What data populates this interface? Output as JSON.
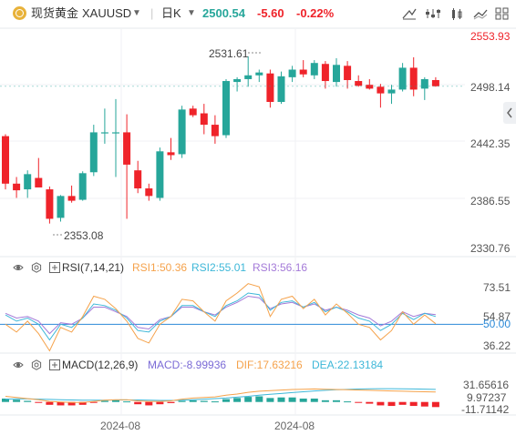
{
  "header": {
    "symbol_name": "现货黄金",
    "symbol_code": "XAUUSD",
    "timeframe": "日K",
    "price": "2500.54",
    "change": "-5.60",
    "change_pct": "-0.22%",
    "tools": [
      "tool-a-icon",
      "tool-b-icon",
      "tool-c-icon",
      "tool-d-icon",
      "grid-icon"
    ]
  },
  "price_axis": [
    "2553.93",
    "2498.14",
    "2442.35",
    "2386.55",
    "2330.76"
  ],
  "price_annotations": {
    "high": "2531.61",
    "low": "2353.08"
  },
  "rsi": {
    "title": "RSI(7,14,21)",
    "rsi1": "RSI1:50.36",
    "rsi2": "RSI2:55.01",
    "rsi3": "RSI3:56.16",
    "axis": [
      "73.51",
      "54.87",
      "50.00",
      "36.22"
    ]
  },
  "macd": {
    "title": "MACD(12,26,9)",
    "macd": "MACD:-8.99936",
    "dif": "DIF:17.63216",
    "dea": "DEA:22.13184",
    "axis": [
      "31.65616",
      "9.97237",
      "-11.71142"
    ]
  },
  "date_labels": [
    "2024-08",
    "2024-08"
  ],
  "colors": {
    "up": "#26a69a",
    "down": "#ef232a",
    "rsi1": "#f5a24b",
    "rsi2": "#3db7d8",
    "rsi3": "#a47ad8",
    "macd": "#7b6bd6",
    "dif": "#f5a24b",
    "dea": "#3db7d8",
    "zero_line": "#2b8ad8"
  },
  "chart_data": {
    "type": "candlestick",
    "candles": [
      {
        "o": 2448,
        "h": 2450,
        "l": 2392,
        "c": 2398
      },
      {
        "o": 2398,
        "h": 2405,
        "l": 2383,
        "c": 2391
      },
      {
        "o": 2392,
        "h": 2412,
        "l": 2383,
        "c": 2408
      },
      {
        "o": 2404,
        "h": 2425,
        "l": 2396,
        "c": 2394
      },
      {
        "o": 2392,
        "h": 2395,
        "l": 2356,
        "c": 2361
      },
      {
        "o": 2362,
        "h": 2386,
        "l": 2358,
        "c": 2385
      },
      {
        "o": 2385,
        "h": 2396,
        "l": 2378,
        "c": 2380
      },
      {
        "o": 2381,
        "h": 2411,
        "l": 2380,
        "c": 2409
      },
      {
        "o": 2410,
        "h": 2460,
        "l": 2406,
        "c": 2452
      },
      {
        "o": 2452,
        "h": 2477,
        "l": 2440,
        "c": 2452
      },
      {
        "o": 2451,
        "h": 2487,
        "l": 2405,
        "c": 2452
      },
      {
        "o": 2452,
        "h": 2471,
        "l": 2361,
        "c": 2418
      },
      {
        "o": 2412,
        "h": 2422,
        "l": 2388,
        "c": 2393
      },
      {
        "o": 2393,
        "h": 2398,
        "l": 2380,
        "c": 2385
      },
      {
        "o": 2383,
        "h": 2436,
        "l": 2380,
        "c": 2432
      },
      {
        "o": 2431,
        "h": 2446,
        "l": 2423,
        "c": 2428
      },
      {
        "o": 2429,
        "h": 2480,
        "l": 2425,
        "c": 2476
      },
      {
        "o": 2477,
        "h": 2480,
        "l": 2468,
        "c": 2470
      },
      {
        "o": 2472,
        "h": 2482,
        "l": 2450,
        "c": 2460
      },
      {
        "o": 2460,
        "h": 2470,
        "l": 2440,
        "c": 2448
      },
      {
        "o": 2449,
        "h": 2508,
        "l": 2446,
        "c": 2506
      },
      {
        "o": 2505,
        "h": 2510,
        "l": 2495,
        "c": 2508
      },
      {
        "o": 2508,
        "h": 2532,
        "l": 2500,
        "c": 2512
      },
      {
        "o": 2512,
        "h": 2518,
        "l": 2505,
        "c": 2515
      },
      {
        "o": 2514,
        "h": 2518,
        "l": 2478,
        "c": 2484
      },
      {
        "o": 2484,
        "h": 2516,
        "l": 2482,
        "c": 2511
      },
      {
        "o": 2510,
        "h": 2522,
        "l": 2505,
        "c": 2518
      },
      {
        "o": 2518,
        "h": 2528,
        "l": 2510,
        "c": 2513
      },
      {
        "o": 2512,
        "h": 2528,
        "l": 2508,
        "c": 2525
      },
      {
        "o": 2524,
        "h": 2527,
        "l": 2498,
        "c": 2506
      },
      {
        "o": 2505,
        "h": 2530,
        "l": 2500,
        "c": 2523
      },
      {
        "o": 2522,
        "h": 2527,
        "l": 2498,
        "c": 2507
      },
      {
        "o": 2506,
        "h": 2512,
        "l": 2500,
        "c": 2501
      },
      {
        "o": 2502,
        "h": 2508,
        "l": 2497,
        "c": 2498
      },
      {
        "o": 2500,
        "h": 2503,
        "l": 2478,
        "c": 2493
      },
      {
        "o": 2493,
        "h": 2502,
        "l": 2482,
        "c": 2497
      },
      {
        "o": 2497,
        "h": 2525,
        "l": 2495,
        "c": 2520
      },
      {
        "o": 2520,
        "h": 2531,
        "l": 2490,
        "c": 2497
      },
      {
        "o": 2498,
        "h": 2510,
        "l": 2486,
        "c": 2508
      },
      {
        "o": 2507,
        "h": 2510,
        "l": 2500,
        "c": 2500.54
      }
    ],
    "rsi1": [
      50,
      45,
      52,
      44,
      33,
      48,
      45,
      55,
      68,
      66,
      60,
      52,
      41,
      38,
      50,
      55,
      66,
      65,
      58,
      52,
      65,
      70,
      76,
      74,
      55,
      66,
      68,
      60,
      66,
      56,
      63,
      57,
      50,
      48,
      40,
      46,
      58,
      50,
      56,
      50.36
    ],
    "rsi2": [
      56,
      52,
      54,
      50,
      40,
      50,
      48,
      54,
      63,
      62,
      59,
      54,
      46,
      45,
      52,
      55,
      62,
      62,
      58,
      55,
      62,
      65,
      70,
      69,
      59,
      64,
      65,
      61,
      64,
      58,
      61,
      58,
      54,
      52,
      46,
      50,
      57,
      53,
      57,
      55.01
    ],
    "rsi3": [
      57,
      54,
      55,
      52,
      44,
      51,
      50,
      54,
      61,
      61,
      58,
      55,
      48,
      47,
      53,
      55,
      61,
      61,
      58,
      56,
      61,
      64,
      68,
      67,
      60,
      63,
      64,
      61,
      63,
      59,
      61,
      59,
      56,
      54,
      49,
      52,
      58,
      55,
      57,
      56.16
    ],
    "macd_hist": [
      6,
      4,
      2,
      -1,
      -5,
      -6,
      -6,
      -5,
      -1,
      2,
      3,
      1,
      -4,
      -6,
      -4,
      -2,
      2,
      3,
      2,
      1,
      5,
      7,
      9,
      10,
      7,
      8,
      8,
      6,
      6,
      3,
      3,
      1,
      -1,
      -3,
      -6,
      -7,
      -5,
      -7,
      -8,
      -8.99936
    ],
    "dif": [
      10,
      8,
      6,
      4,
      1,
      0,
      -1,
      -1,
      1,
      3,
      4,
      4,
      2,
      1,
      1,
      2,
      5,
      7,
      8,
      9,
      12,
      14,
      17,
      19,
      20,
      21,
      22,
      22.5,
      23,
      22.5,
      22,
      21.5,
      21,
      20.5,
      20,
      19.5,
      19,
      18.5,
      18,
      17.63216
    ],
    "dea": [
      5,
      5.5,
      5.5,
      5,
      4.5,
      4,
      3.5,
      3,
      3,
      3,
      3.5,
      3.5,
      3.5,
      3,
      2.8,
      2.8,
      3.2,
      4,
      5,
      6,
      7,
      8.5,
      10,
      12,
      13.5,
      15,
      16.5,
      18,
      19.5,
      20.5,
      21.5,
      22.2,
      22.8,
      23.2,
      23.4,
      23.5,
      23.3,
      23,
      22.6,
      22.13184
    ]
  }
}
